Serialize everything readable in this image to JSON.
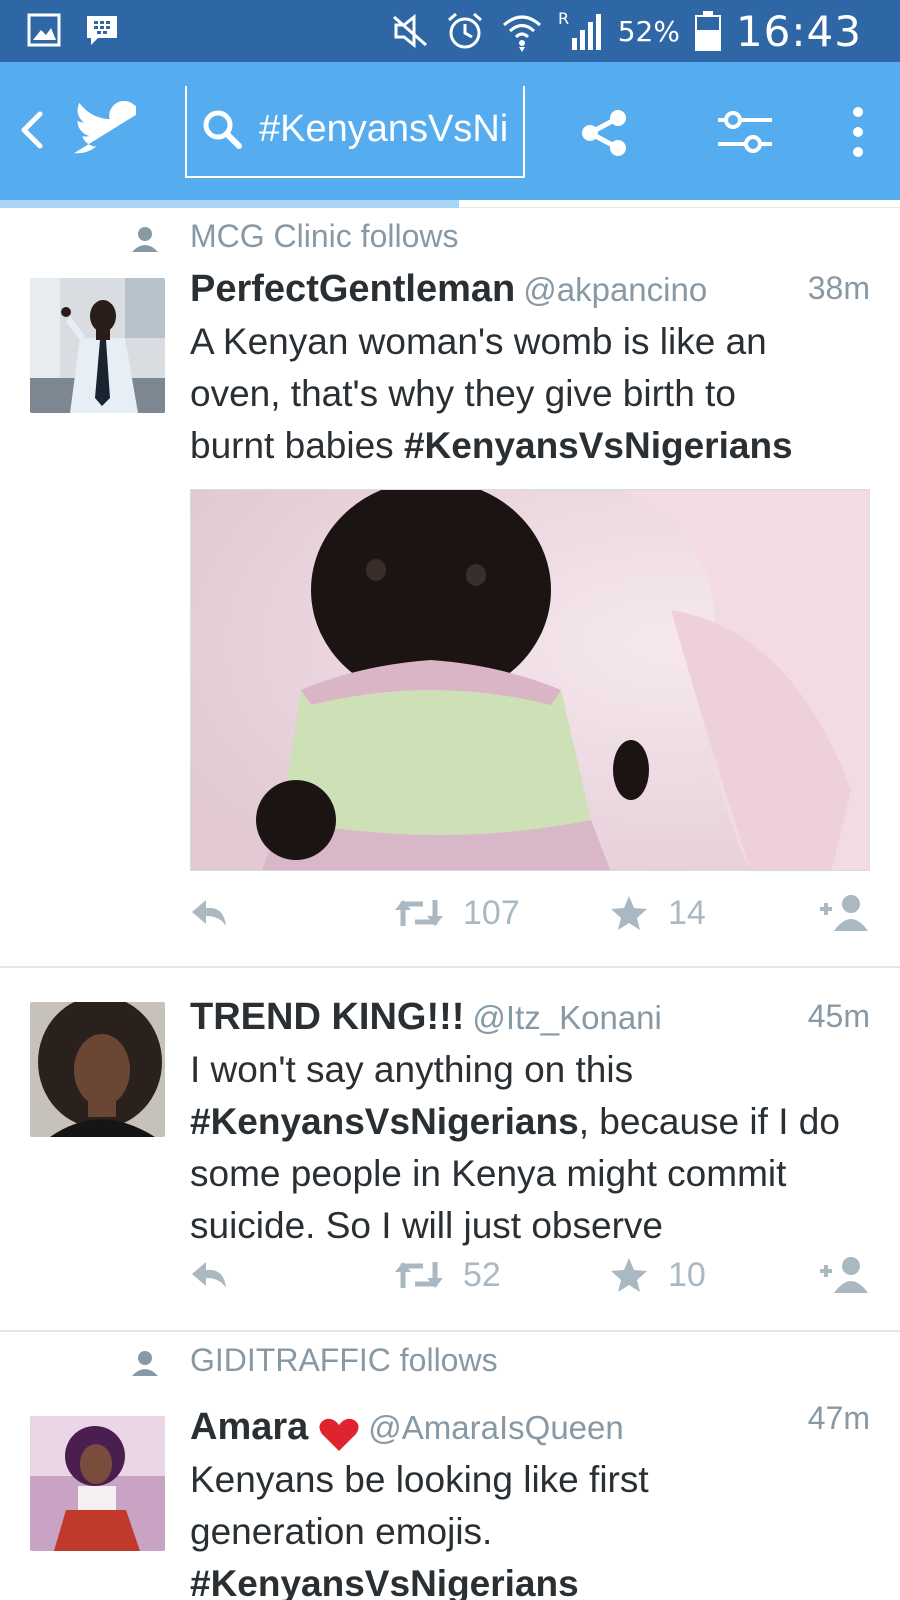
{
  "status_bar": {
    "battery_percent": "52%",
    "time": "16:43",
    "icons": [
      "gallery-icon",
      "blackberry-messenger-icon",
      "mute-icon",
      "alarm-icon",
      "wifi-icon",
      "signal-roaming-icon",
      "battery-icon"
    ]
  },
  "app_bar": {
    "search_query": "#KenyansVsNi",
    "icons": [
      "back-icon",
      "twitter-bird-icon",
      "search-icon",
      "share-icon",
      "filter-icon",
      "overflow-menu-icon"
    ],
    "accent_color": "#55acee",
    "loading_progress": 0.51
  },
  "tweets": [
    {
      "social_context": "MCG Clinic follows",
      "name": "PerfectGentleman",
      "handle": "@akpancino",
      "time": "38m",
      "text_lines": [
        "A Kenyan woman's womb is like an",
        "oven, that's why they give birth to"
      ],
      "text_last_plain": "burnt babies ",
      "text_last_hashtag": "#KenyansVsNigerians",
      "has_media": true,
      "retweets": "107",
      "favorites": "14"
    },
    {
      "name": "TREND KING!!!",
      "handle": "@Itz_Konani",
      "time": "45m",
      "line1": "I won't say anything on this",
      "line2_hashtag": "#KenyansVsNigerians",
      "line2_rest": ", because if I do",
      "line3": "some people in Kenya might commit",
      "line4": "suicide. So I will just observe",
      "retweets": "52",
      "favorites": "10"
    },
    {
      "social_context": "GIDITRAFFIC follows",
      "name": "Amara",
      "handle": "@AmaraIsQueen",
      "time": "47m",
      "line1": "Kenyans be looking like first",
      "line2": "generation emojis.",
      "line3_hashtag": "#KenyansVsNigerians"
    }
  ]
}
